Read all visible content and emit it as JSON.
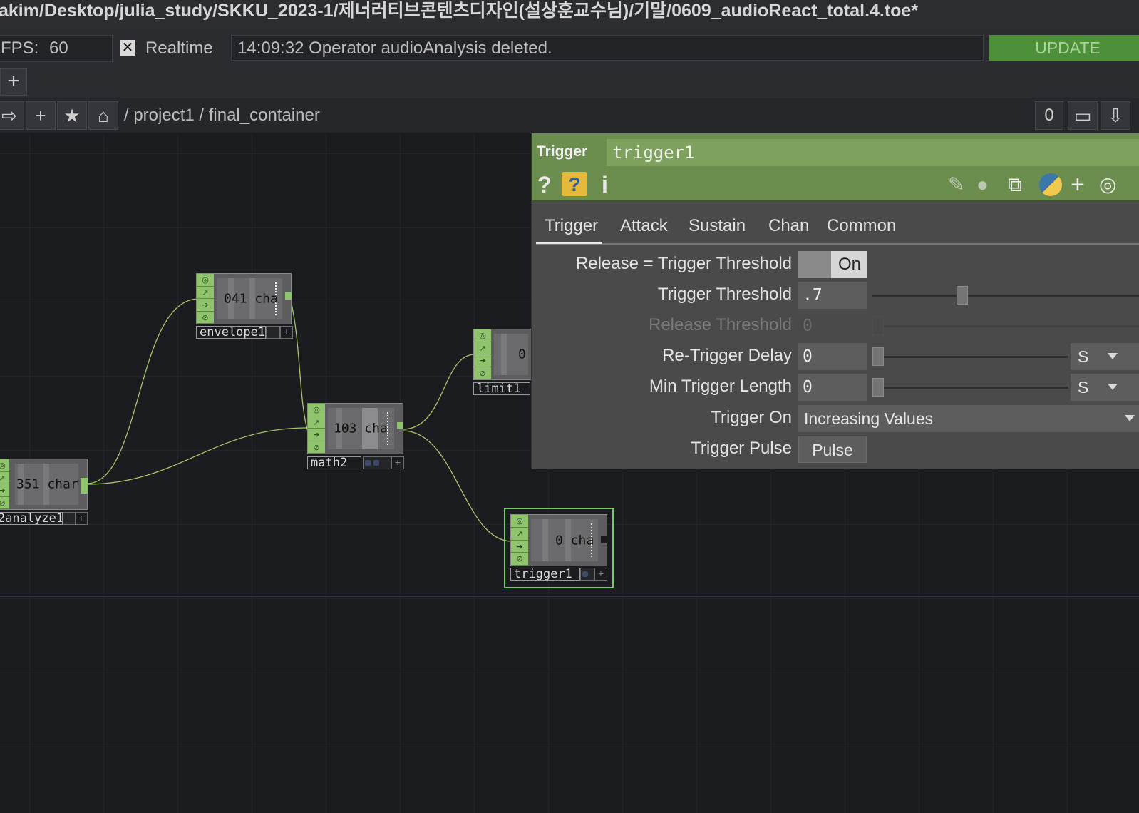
{
  "window": {
    "title": "akim/Desktop/julia_study/SKKU_2023-1/제너러티브콘텐츠디자인(설상훈교수님)/기말/0609_audioReact_total.4.toe*"
  },
  "toolbar": {
    "fps_label": "FPS:",
    "fps_value": "60",
    "realtime_checked": true,
    "realtime_label": "Realtime",
    "status_message": "14:09:32 Operator audioAnalysis deleted.",
    "update_label": "UPDATE"
  },
  "pane": {
    "add_icon": "plus-icon"
  },
  "pathbar": {
    "back_icon": "arrow-right-icon",
    "add_icon": "plus-icon",
    "star_icon": "star-icon",
    "home_icon": "home-icon",
    "path": "/ project1 / final_container",
    "counter": "0"
  },
  "network": {
    "nodes": [
      {
        "name": "envelope1",
        "readout": "041 cha"
      },
      {
        "name": "math2",
        "readout": "103 cha"
      },
      {
        "name": "limit1",
        "readout": "0"
      },
      {
        "name": "2analyze1",
        "readout": "351 char"
      },
      {
        "name": "trigger1",
        "readout": "0 cha",
        "selected": true
      }
    ]
  },
  "params": {
    "op_type": "Trigger",
    "op_name": "trigger1",
    "header_icons": [
      "help-icon",
      "python-help-icon",
      "info-icon"
    ],
    "tool_icons": [
      "pencil-icon",
      "comment-icon",
      "clone-icon",
      "python-icon",
      "plus-icon",
      "target-icon"
    ],
    "tabs": [
      "Trigger",
      "Attack",
      "Sustain",
      "Chan",
      "Common"
    ],
    "active_tab": "Trigger",
    "rows": {
      "release_eq": {
        "label": "Release = Trigger Threshold",
        "value": "On"
      },
      "trigger_threshold": {
        "label": "Trigger Threshold",
        "value": ".7",
        "level": 0.35
      },
      "release_threshold": {
        "label": "Release Threshold",
        "value": "0",
        "disabled": true
      },
      "retrigger_delay": {
        "label": "Re-Trigger Delay",
        "value": "0",
        "unit": "S"
      },
      "min_trigger_length": {
        "label": "Min Trigger Length",
        "value": "0",
        "unit": "S"
      },
      "trigger_on": {
        "label": "Trigger On",
        "value": "Increasing Values"
      },
      "trigger_pulse": {
        "label": "Trigger Pulse",
        "button": "Pulse"
      }
    }
  },
  "colors": {
    "accent_green": "#6b8d4e",
    "update_green": "#4e8f3a",
    "node_inlet_green": "#8fc46d",
    "selection_green": "#6fd05a"
  }
}
